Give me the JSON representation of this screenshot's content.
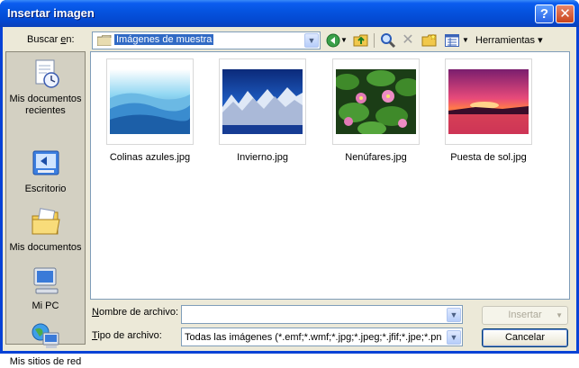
{
  "window": {
    "title": "Insertar imagen"
  },
  "title_buttons": {
    "help": "?",
    "close": "✕"
  },
  "lookin": {
    "label": "Buscar en:",
    "value": "Imágenes de muestra"
  },
  "toolbar": {
    "tools_label": "Herramientas"
  },
  "places": [
    {
      "label": "Mis documentos recientes",
      "icon": "recent-documents-icon"
    },
    {
      "label": "Escritorio",
      "icon": "desktop-icon"
    },
    {
      "label": "Mis documentos",
      "icon": "my-documents-icon"
    },
    {
      "label": "Mi PC",
      "icon": "my-computer-icon"
    },
    {
      "label": "Mis sitios de red",
      "icon": "network-places-icon"
    }
  ],
  "files": [
    {
      "name": "Colinas azules.jpg"
    },
    {
      "name": "Invierno.jpg"
    },
    {
      "name": "Nenúfares.jpg"
    },
    {
      "name": "Puesta de sol.jpg"
    }
  ],
  "filename": {
    "label": "Nombre de archivo:",
    "value": ""
  },
  "filetype": {
    "label": "Tipo de archivo:",
    "value": "Todas las imágenes (*.emf;*.wmf;*.jpg;*.jpeg;*.jfif;*.jpe;*.pn"
  },
  "buttons": {
    "insert": "Insertar",
    "cancel": "Cancelar"
  }
}
